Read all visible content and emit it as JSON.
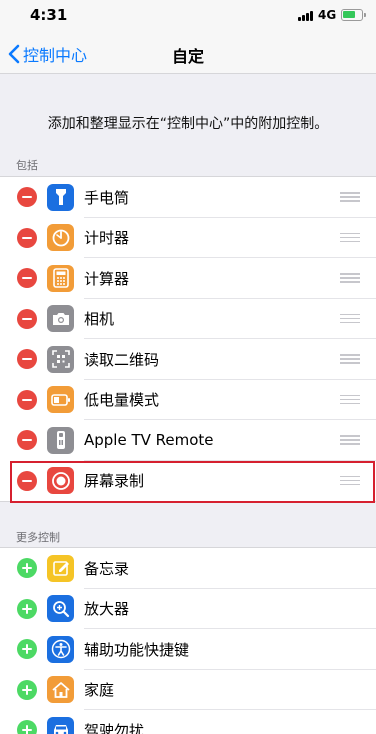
{
  "status_bar": {
    "time": "4:31",
    "network": "4G"
  },
  "nav": {
    "back_label": "控制中心",
    "title": "自定"
  },
  "description": "添加和整理显示在“控制中心”中的附加控制。",
  "included": {
    "header": "包括",
    "items": [
      {
        "label": "手电筒",
        "icon": "flashlight-icon",
        "color": "#1b6fe0"
      },
      {
        "label": "计时器",
        "icon": "timer-icon",
        "color": "#f29c38"
      },
      {
        "label": "计算器",
        "icon": "calculator-icon",
        "color": "#f29c38"
      },
      {
        "label": "相机",
        "icon": "camera-icon",
        "color": "#8e8e93"
      },
      {
        "label": "读取二维码",
        "icon": "qr-code-icon",
        "color": "#8e8e93"
      },
      {
        "label": "低电量模式",
        "icon": "low-power-icon",
        "color": "#f29c38"
      },
      {
        "label": "Apple TV Remote",
        "icon": "tv-remote-icon",
        "color": "#8e8e93"
      },
      {
        "label": "屏幕录制",
        "icon": "screen-record-icon",
        "color": "#e8473f"
      }
    ]
  },
  "more": {
    "header": "更多控制",
    "items": [
      {
        "label": "备忘录",
        "icon": "notes-icon",
        "color": "#f5c426"
      },
      {
        "label": "放大器",
        "icon": "magnifier-icon",
        "color": "#1b6fe0"
      },
      {
        "label": "辅助功能快捷键",
        "icon": "accessibility-icon",
        "color": "#1b6fe0"
      },
      {
        "label": "家庭",
        "icon": "home-icon",
        "color": "#f29c38"
      },
      {
        "label": "驾驶勿扰",
        "icon": "car-icon",
        "color": "#1b6fe0"
      }
    ]
  },
  "highlighted_item": "屏幕录制",
  "highlight_color": "#d6202f",
  "accent_color": "#0a7aff"
}
